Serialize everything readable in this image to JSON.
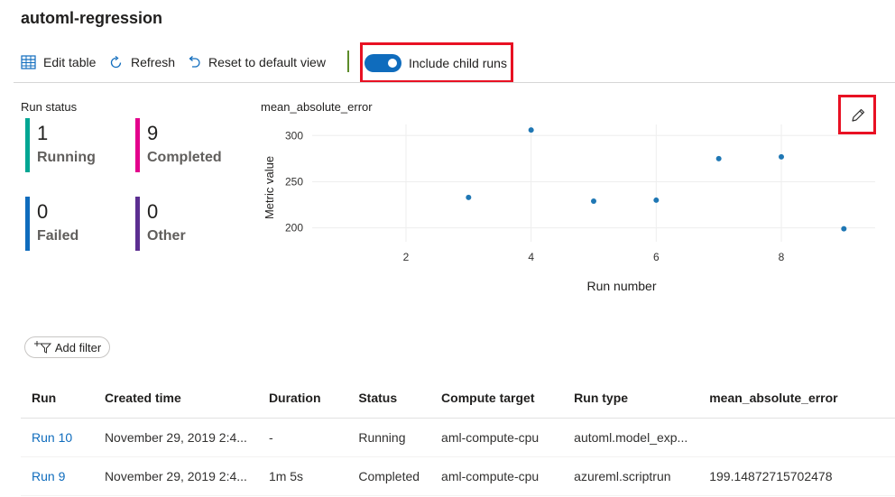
{
  "page": {
    "title": "automl-regression"
  },
  "toolbar": {
    "edit_table": "Edit table",
    "refresh": "Refresh",
    "reset_view": "Reset to default view",
    "include_child_runs": "Include child runs",
    "include_child_runs_on": true
  },
  "run_status": {
    "title": "Run status",
    "items": [
      {
        "count": "1",
        "label": "Running",
        "color": "#00a693"
      },
      {
        "count": "9",
        "label": "Completed",
        "color": "#e3008c"
      },
      {
        "count": "0",
        "label": "Failed",
        "color": "#0f6cbd"
      },
      {
        "count": "0",
        "label": "Other",
        "color": "#5c2e91"
      }
    ]
  },
  "chart_data": {
    "type": "scatter",
    "title": "mean_absolute_error",
    "xlabel": "Run number",
    "ylabel": "Metric value",
    "xlim": [
      0.5,
      9.5
    ],
    "ylim": [
      185,
      312
    ],
    "x_ticks": [
      2,
      4,
      6,
      8
    ],
    "y_ticks": [
      200,
      250,
      300
    ],
    "grid": true,
    "series": [
      {
        "color": "#1f77b4",
        "x": [
          3,
          4,
          5,
          6,
          7,
          8,
          9
        ],
        "y": [
          233,
          306,
          229,
          230,
          275,
          277,
          199
        ]
      }
    ]
  },
  "filter": {
    "add_filter_label": "Add filter"
  },
  "table": {
    "columns": [
      "Run",
      "Created time",
      "Duration",
      "Status",
      "Compute target",
      "Run type",
      "mean_absolute_error"
    ],
    "rows": [
      {
        "run": "Run 10",
        "created": "November 29, 2019 2:4...",
        "duration": "-",
        "status": "Running",
        "compute": "aml-compute-cpu",
        "run_type": "automl.model_exp...",
        "metric": ""
      },
      {
        "run": "Run 9",
        "created": "November 29, 2019 2:4...",
        "duration": "1m 5s",
        "status": "Completed",
        "compute": "aml-compute-cpu",
        "run_type": "azureml.scriptrun",
        "metric": "199.14872715702478"
      }
    ]
  },
  "icons": {
    "edit_table": "table-grid-icon",
    "refresh": "refresh-icon",
    "reset": "undo-icon",
    "edit_chart": "pencil-icon",
    "add_filter": "filter-add-icon"
  }
}
